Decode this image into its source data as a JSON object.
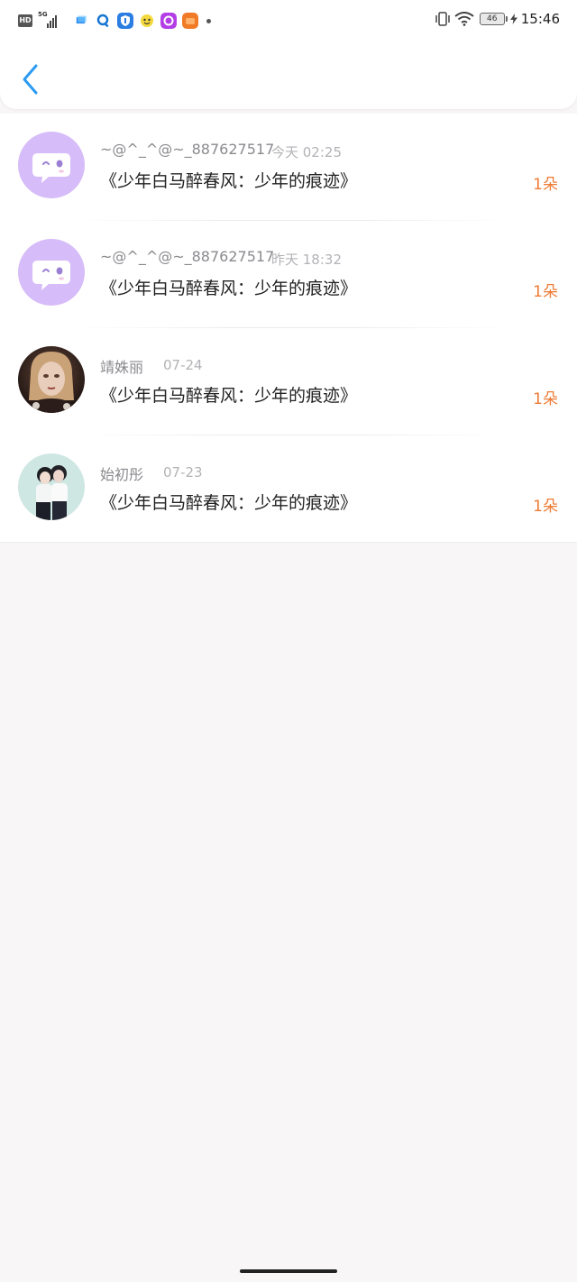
{
  "status_bar": {
    "hd": "HD",
    "network": "5G",
    "battery": "46",
    "time": "15:46",
    "icons": [
      "hd-icon",
      "5g-signal-icon",
      "app-icon-blue",
      "app-icon-search",
      "app-icon-shield",
      "app-icon-emoji",
      "app-icon-purple",
      "app-icon-orange",
      "dot-icon",
      "vibrate-icon",
      "wifi-icon",
      "battery-icon",
      "charging-icon"
    ]
  },
  "header": {
    "back_icon": "chevron-left-icon"
  },
  "colors": {
    "accent_back": "#2b9bf4",
    "count": "#ef7b34",
    "avatar_bubble": "#d3b8f7"
  },
  "items": [
    {
      "name": "~@^_^@~_887627517",
      "time": "今天 02:25",
      "title": "《少年白马醉春风：少年的痕迹》",
      "count": "1朵",
      "avatar": "chat-bubble-avatar"
    },
    {
      "name": "~@^_^@~_887627517",
      "time": "昨天 18:32",
      "title": "《少年白马醉春风：少年的痕迹》",
      "count": "1朵",
      "avatar": "chat-bubble-avatar"
    },
    {
      "name": "靖姝丽",
      "time": "07-24",
      "title": "《少年白马醉春风：少年的痕迹》",
      "count": "1朵",
      "avatar": "photo-avatar"
    },
    {
      "name": "始初彤",
      "time": "07-23",
      "title": "《少年白马醉春风：少年的痕迹》",
      "count": "1朵",
      "avatar": "photo-avatar"
    }
  ]
}
